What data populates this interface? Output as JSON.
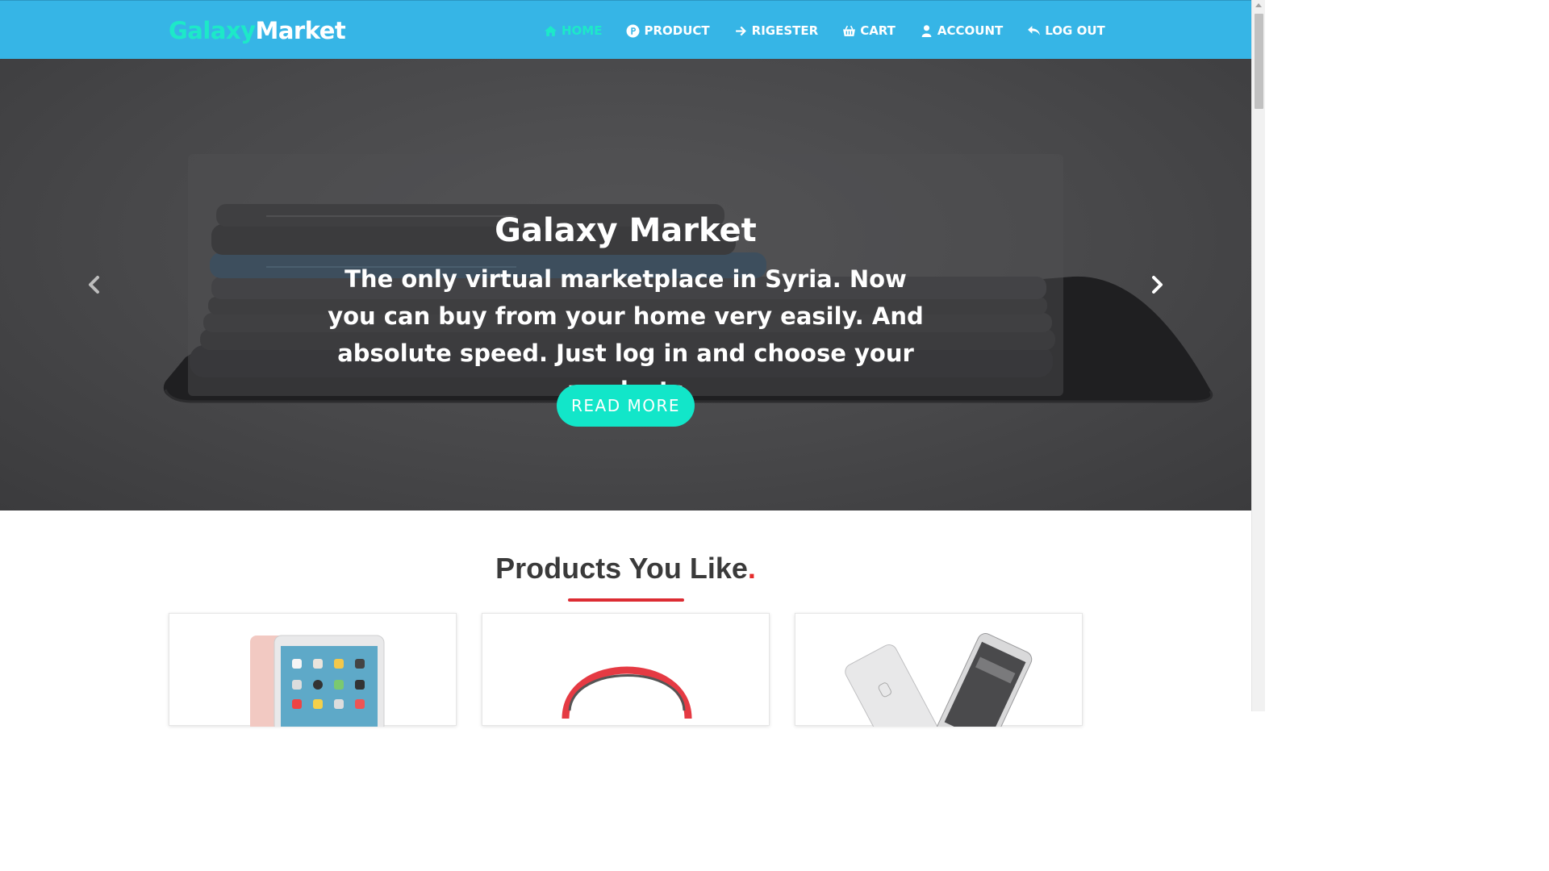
{
  "brand": {
    "part1": "Galaxy",
    "part2": "Market"
  },
  "nav": {
    "items": [
      {
        "label": "HOME",
        "icon": "home-icon",
        "active": true
      },
      {
        "label": "PRODUCT",
        "icon": "product-p-icon",
        "active": false
      },
      {
        "label": "RIGESTER",
        "icon": "arrow-right-icon",
        "active": false
      },
      {
        "label": "CART",
        "icon": "cart-icon",
        "active": false
      },
      {
        "label": "ACCOUNT",
        "icon": "user-icon",
        "active": false
      },
      {
        "label": "LOG OUT",
        "icon": "logout-icon",
        "active": false
      }
    ]
  },
  "hero": {
    "title": "Galaxy Market",
    "text": "The only virtual marketplace in Syria. Now you can buy from your home very easily. And absolute speed. Just log in and choose your products",
    "button": "READ MORE",
    "prev_icon": "chevron-left-icon",
    "next_icon": "chevron-right-icon"
  },
  "products": {
    "title": "Products You Like",
    "title_dot": ".",
    "cards": [
      {
        "image": "tablet-image"
      },
      {
        "image": "headphones-image"
      },
      {
        "image": "smartphones-image"
      }
    ]
  },
  "colors": {
    "navbar": "#36b5e6",
    "accent": "#1de9c8",
    "button": "#12e6c9",
    "underline": "#dc2c33"
  }
}
